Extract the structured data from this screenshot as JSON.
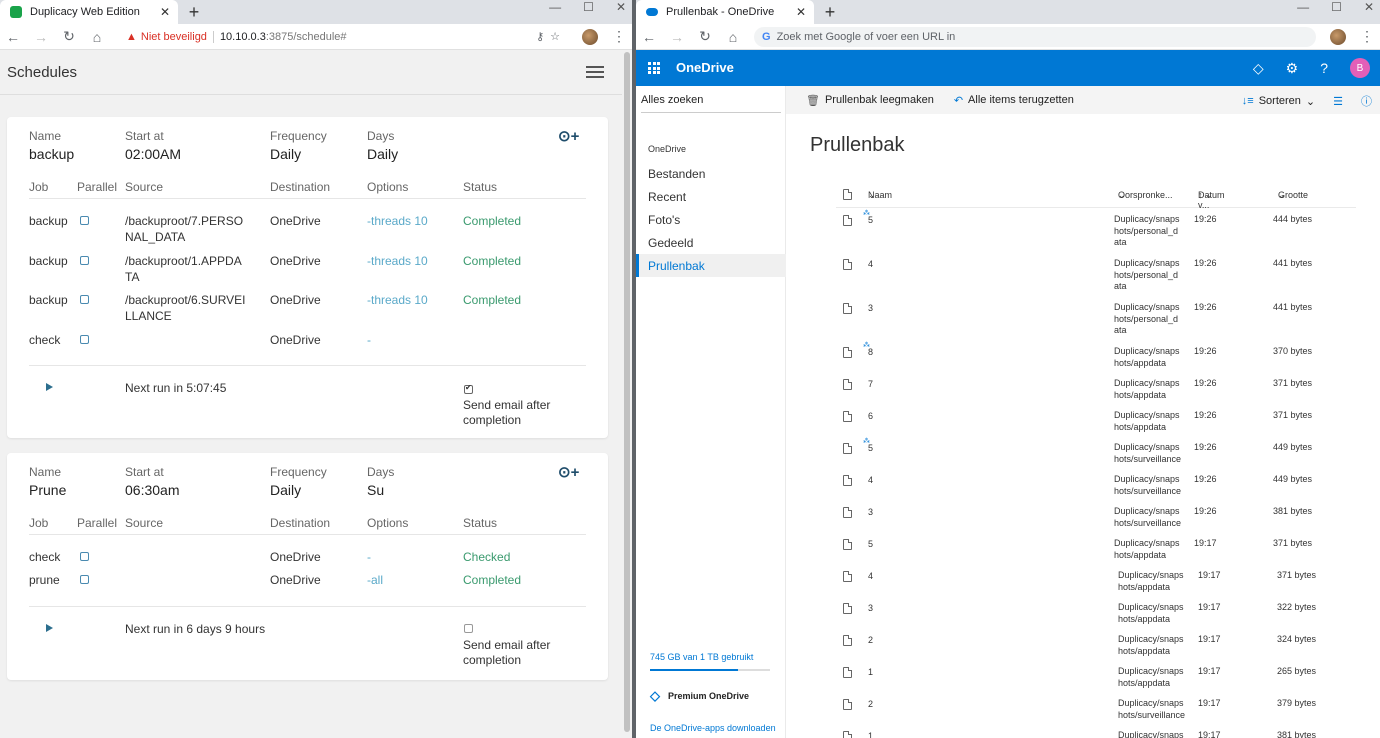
{
  "left_window": {
    "tab_title": "Duplicacy Web Edition",
    "warning": "Niet beveiligd",
    "url_host": "10.10.0.3",
    "url_rest": ":3875/schedule#",
    "page_title": "Schedules",
    "schedules": [
      {
        "name_label": "Name",
        "name": "backup",
        "start_label": "Start at",
        "start": "02:00AM",
        "freq_label": "Frequency",
        "freq": "Daily",
        "days_label": "Days",
        "days": "Daily",
        "cols": [
          "Job",
          "Parallel",
          "Source",
          "Destination",
          "Options",
          "Status"
        ],
        "jobs": [
          {
            "job": "backup",
            "source1": "/backuproot/7.PERSO",
            "source2": "NAL_DATA",
            "dest": "OneDrive",
            "opt": "-threads 10",
            "status": "Completed"
          },
          {
            "job": "backup",
            "source1": "/backuproot/1.APPDA",
            "source2": "TA",
            "dest": "OneDrive",
            "opt": "-threads 10",
            "status": "Completed"
          },
          {
            "job": "backup",
            "source1": "/backuproot/6.SURVEI",
            "source2": "LLANCE",
            "dest": "OneDrive",
            "opt": "-threads 10",
            "status": "Completed"
          },
          {
            "job": "check",
            "source1": "",
            "source2": "",
            "dest": "OneDrive",
            "opt": "-",
            "status": ""
          }
        ],
        "next_run": "Next run in 5:07:45",
        "email1": "Send email after",
        "email2": "completion",
        "email_checked": true
      },
      {
        "name_label": "Name",
        "name": "Prune",
        "start_label": "Start at",
        "start": "06:30am",
        "freq_label": "Frequency",
        "freq": "Daily",
        "days_label": "Days",
        "days": "Su",
        "cols": [
          "Job",
          "Parallel",
          "Source",
          "Destination",
          "Options",
          "Status"
        ],
        "jobs": [
          {
            "job": "check",
            "source1": "",
            "source2": "",
            "dest": "OneDrive",
            "opt": "-",
            "status": "Checked"
          },
          {
            "job": "prune",
            "source1": "",
            "source2": "",
            "dest": "OneDrive",
            "opt": "-all",
            "status": "Completed"
          }
        ],
        "next_run": "Next run in 6 days 9 hours",
        "email1": "Send email after",
        "email2": "completion",
        "email_checked": false
      }
    ]
  },
  "right_window": {
    "tab_title": "Prullenbak - OneDrive",
    "omnibox_placeholder": "Zoek met Google of voer een URL in",
    "brand": "OneDrive",
    "avatar_letter": "B",
    "search": "Alles zoeken",
    "nav_header": "OneDrive",
    "nav": [
      "Bestanden",
      "Recent",
      "Foto's",
      "Gedeeld",
      "Prullenbak"
    ],
    "quota": "745 GB van 1 TB gebruikt",
    "quota_fraction": 0.73,
    "premium": "Premium OneDrive",
    "download": "De OneDrive-apps downloaden",
    "cmd_empty": "Prullenbak leegmaken",
    "cmd_restore": "Alle items terugzetten",
    "cmd_sort": "Sorteren",
    "page_title": "Prullenbak",
    "col_name": "Naam",
    "col_origin": "Oorspronke...",
    "col_date": "Datum v...",
    "col_size": "Grootte",
    "files": [
      {
        "name": "5",
        "o1": "Duplicacy/snaps",
        "o2": "hots/personal_d",
        "o3": "ata",
        "date": "19:26",
        "size": "444 bytes",
        "spin": true
      },
      {
        "name": "4",
        "o1": "Duplicacy/snaps",
        "o2": "hots/personal_d",
        "o3": "ata",
        "date": "19:26",
        "size": "441 bytes",
        "spin": false
      },
      {
        "name": "3",
        "o1": "Duplicacy/snaps",
        "o2": "hots/personal_d",
        "o3": "ata",
        "date": "19:26",
        "size": "441 bytes",
        "spin": false
      },
      {
        "name": "8",
        "o1": "Duplicacy/snaps",
        "o2": "hots/appdata",
        "o3": "",
        "date": "19:26",
        "size": "370 bytes",
        "spin": true
      },
      {
        "name": "7",
        "o1": "Duplicacy/snaps",
        "o2": "hots/appdata",
        "o3": "",
        "date": "19:26",
        "size": "371 bytes",
        "spin": false
      },
      {
        "name": "6",
        "o1": "Duplicacy/snaps",
        "o2": "hots/appdata",
        "o3": "",
        "date": "19:26",
        "size": "371 bytes",
        "spin": false
      },
      {
        "name": "5",
        "o1": "Duplicacy/snaps",
        "o2": "hots/surveillance",
        "o3": "",
        "date": "19:26",
        "size": "449 bytes",
        "spin": true
      },
      {
        "name": "4",
        "o1": "Duplicacy/snaps",
        "o2": "hots/surveillance",
        "o3": "",
        "date": "19:26",
        "size": "449 bytes",
        "spin": false
      },
      {
        "name": "3",
        "o1": "Duplicacy/snaps",
        "o2": "hots/surveillance",
        "o3": "",
        "date": "19:26",
        "size": "381 bytes",
        "spin": false
      },
      {
        "name": "5",
        "o1": "Duplicacy/snaps",
        "o2": "hots/appdata",
        "o3": "",
        "date": "19:17",
        "size": "371 bytes",
        "spin": false
      },
      {
        "name": "4",
        "o1": "Duplicacy/snaps",
        "o2": "hots/appdata",
        "o3": "",
        "date": "19:17",
        "size": "371 bytes",
        "spin": false
      },
      {
        "name": "3",
        "o1": "Duplicacy/snaps",
        "o2": "hots/appdata",
        "o3": "",
        "date": "19:17",
        "size": "322 bytes",
        "spin": false
      },
      {
        "name": "2",
        "o1": "Duplicacy/snaps",
        "o2": "hots/appdata",
        "o3": "",
        "date": "19:17",
        "size": "324 bytes",
        "spin": false
      },
      {
        "name": "1",
        "o1": "Duplicacy/snaps",
        "o2": "hots/appdata",
        "o3": "",
        "date": "19:17",
        "size": "265 bytes",
        "spin": false
      },
      {
        "name": "2",
        "o1": "Duplicacy/snaps",
        "o2": "hots/surveillance",
        "o3": "",
        "date": "19:17",
        "size": "379 bytes",
        "spin": false
      },
      {
        "name": "1",
        "o1": "Duplicacy/snaps",
        "o2": "",
        "o3": "",
        "date": "19:17",
        "size": "381 bytes",
        "spin": false
      }
    ]
  }
}
